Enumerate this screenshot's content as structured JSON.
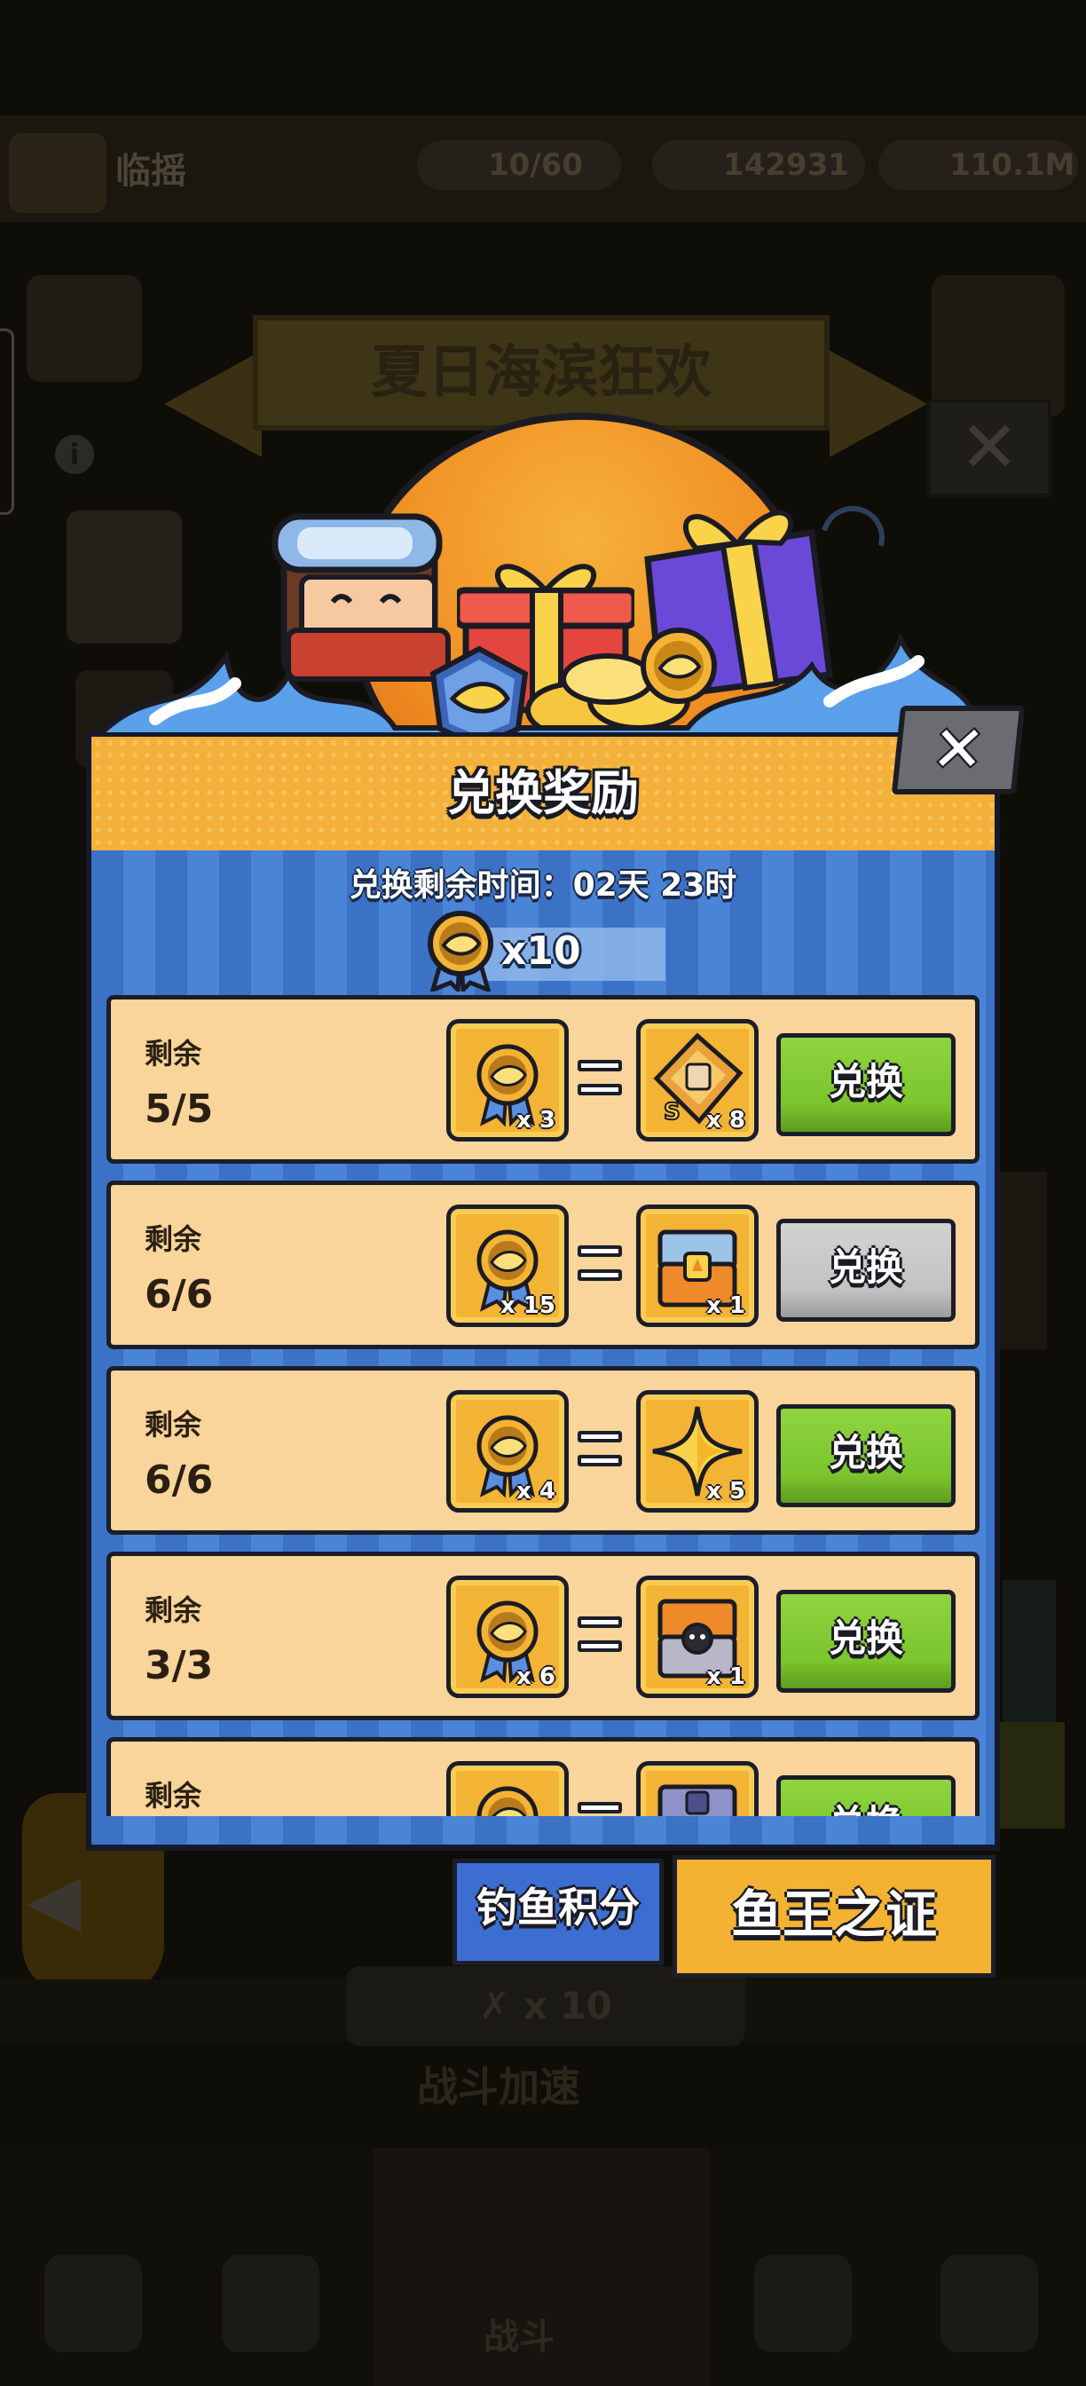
{
  "background": {
    "player_name": "临摇",
    "energy": "10/60",
    "gems": "142931",
    "gold": "110.1M",
    "event_banner_title": "夏日海滨狂欢",
    "close_glyph": "✕",
    "info_glyph": "i",
    "back_glyph": "◀",
    "bottom_multiplier": "✗ x 10",
    "battle_speed": "战斗加速",
    "nav_battle": "战斗"
  },
  "dialog": {
    "title": "兑换奖励",
    "close_glyph": "✕",
    "timer_text": "兑换剩余时间：02天 23时",
    "currency": {
      "icon": "fish-medal-icon",
      "count": "x10"
    },
    "rows": [
      {
        "remain_label": "剩余",
        "remain": "5/5",
        "cost_qty": "x 3",
        "reward_icon": "s-rank-shard-icon",
        "reward_qty": "x 8",
        "button": "兑换",
        "enabled": true
      },
      {
        "remain_label": "剩余",
        "remain": "6/6",
        "cost_qty": "x 15",
        "reward_icon": "orange-chest-icon",
        "reward_qty": "x 1",
        "button": "兑换",
        "enabled": false
      },
      {
        "remain_label": "剩余",
        "remain": "6/6",
        "cost_qty": "x 4",
        "reward_icon": "gold-star-icon",
        "reward_qty": "x 5",
        "button": "兑换",
        "enabled": true
      },
      {
        "remain_label": "剩余",
        "remain": "3/3",
        "cost_qty": "x 6",
        "reward_icon": "black-chest-icon",
        "reward_qty": "x 1",
        "button": "兑换",
        "enabled": true
      },
      {
        "remain_label": "剩余",
        "remain": "",
        "cost_qty": "",
        "reward_icon": "purple-chest-icon",
        "reward_qty": "",
        "button": "兑换",
        "enabled": true
      }
    ]
  },
  "tabs": {
    "fishing_points": "钓鱼积分",
    "fish_king_proof": "鱼王之证"
  },
  "colors": {
    "header_orange": "#f3b13b",
    "panel_blue": "#3c72c6",
    "row_cream": "#f9d49b",
    "button_green": "#7cc52e",
    "button_gray": "#c3c3c3",
    "tab_blue": "#3c6ed2",
    "tab_orange": "#f4b232"
  }
}
